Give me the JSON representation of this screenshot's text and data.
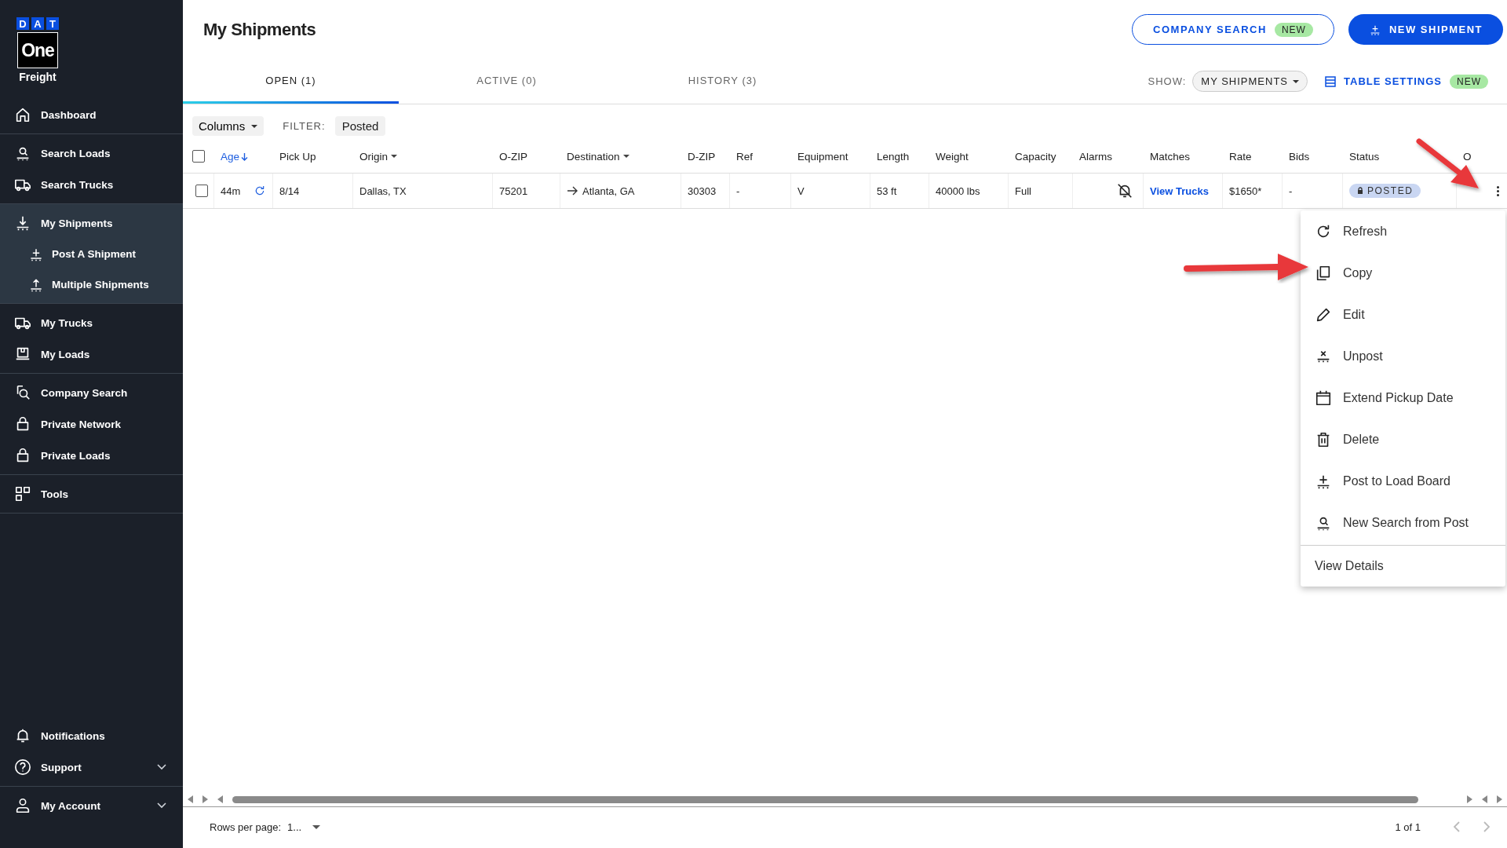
{
  "logo": {
    "letters": [
      "D",
      "A",
      "T"
    ],
    "wordmark": "One",
    "product": "Freight"
  },
  "sidebar": {
    "groups": [
      {
        "items": [
          {
            "label": "Dashboard",
            "kind": "home",
            "selected": false
          }
        ]
      },
      {
        "items": [
          {
            "label": "Search Loads",
            "kind": "search",
            "selected": false
          },
          {
            "label": "Search Trucks",
            "kind": "truck",
            "selected": false
          }
        ]
      },
      {
        "items": [
          {
            "label": "My Shipments",
            "kind": "download",
            "selected": true,
            "expanded": true,
            "children": [
              {
                "label": "Post A Shipment",
                "kind": "plus"
              },
              {
                "label": "Multiple Shipments",
                "kind": "upload"
              }
            ]
          }
        ]
      },
      {
        "items": [
          {
            "label": "My Trucks",
            "kind": "truck",
            "selected": false
          },
          {
            "label": "My Loads",
            "kind": "box",
            "selected": false
          }
        ]
      },
      {
        "items": [
          {
            "label": "Company Search",
            "kind": "find",
            "selected": false
          },
          {
            "label": "Private Network",
            "kind": "lock",
            "selected": false
          },
          {
            "label": "Private Loads",
            "kind": "lock",
            "selected": false
          }
        ]
      },
      {
        "items": [
          {
            "label": "Tools",
            "kind": "grid",
            "selected": false
          }
        ]
      }
    ],
    "bottom": [
      {
        "items": [
          {
            "label": "Notifications",
            "kind": "bell",
            "selected": false
          },
          {
            "label": "Support",
            "kind": "help",
            "selected": false,
            "expanded": false
          }
        ]
      },
      {
        "items": [
          {
            "label": "My Account",
            "kind": "user",
            "selected": false,
            "expanded": false
          }
        ]
      }
    ]
  },
  "header": {
    "title": "My Shipments",
    "buttons": [
      {
        "label": "COMPANY SEARCH",
        "badge": "NEW",
        "kind": "outline"
      },
      {
        "label": "NEW SHIPMENT",
        "kind": "primary"
      }
    ]
  },
  "tabs": [
    {
      "label": "OPEN (1)",
      "selected": true
    },
    {
      "label": "ACTIVE (0)",
      "selected": false
    },
    {
      "label": "HISTORY (3)",
      "selected": false
    }
  ],
  "show": {
    "label": "SHOW:",
    "value": "MY SHIPMENTS"
  },
  "table_settings": {
    "label": "TABLE SETTINGS",
    "badge": "NEW"
  },
  "toolbar": {
    "columns": "Columns",
    "filter_label": "FILTER:",
    "filter_value": "Posted"
  },
  "table": {
    "select_all": {
      "checked": false
    },
    "columns": [
      {
        "label": "Age",
        "kind": "sort"
      },
      {
        "label": "Pick Up",
        "kind": "plain"
      },
      {
        "label": "Origin",
        "kind": "menu"
      },
      {
        "label": "O-ZIP",
        "kind": "plain"
      },
      {
        "label": "Destination",
        "kind": "menu"
      },
      {
        "label": "D-ZIP",
        "kind": "plain"
      },
      {
        "label": "Ref",
        "kind": "plain"
      },
      {
        "label": "Equipment",
        "kind": "plain"
      },
      {
        "label": "Length",
        "kind": "plain"
      },
      {
        "label": "Weight",
        "kind": "plain"
      },
      {
        "label": "Capacity",
        "kind": "plain"
      },
      {
        "label": "Alarms",
        "kind": "plain"
      },
      {
        "label": "Matches",
        "kind": "plain"
      },
      {
        "label": "Rate",
        "kind": "plain"
      },
      {
        "label": "Bids",
        "kind": "plain"
      },
      {
        "label": "Status",
        "kind": "plain"
      },
      {
        "label": "O",
        "kind": "plain"
      }
    ],
    "rows": [
      {
        "checked": false,
        "cells": [
          {
            "kind": "age",
            "text": "44m"
          },
          {
            "kind": "text",
            "text": "8/14"
          },
          {
            "kind": "text",
            "text": "Dallas, TX"
          },
          {
            "kind": "text",
            "text": "75201"
          },
          {
            "kind": "route",
            "text": "Atlanta, GA"
          },
          {
            "kind": "text",
            "text": "30303"
          },
          {
            "kind": "text",
            "text": "-"
          },
          {
            "kind": "text",
            "text": "V"
          },
          {
            "kind": "text",
            "text": "53 ft"
          },
          {
            "kind": "text",
            "text": "40000 lbs"
          },
          {
            "kind": "text",
            "text": "Full"
          },
          {
            "kind": "alarm"
          },
          {
            "kind": "link",
            "text": "View Trucks"
          },
          {
            "kind": "text",
            "text": "$1650*"
          },
          {
            "kind": "text",
            "text": "-"
          },
          {
            "kind": "badge",
            "text": "POSTED"
          },
          {
            "kind": "menu"
          }
        ]
      }
    ]
  },
  "menu": {
    "items": [
      {
        "label": "Refresh",
        "kind": "refresh"
      },
      {
        "label": "Copy",
        "kind": "copy"
      },
      {
        "label": "Edit",
        "kind": "edit"
      },
      {
        "label": "Unpost",
        "kind": "unpost"
      },
      {
        "label": "Extend Pickup Date",
        "kind": "calendar"
      },
      {
        "label": "Delete",
        "kind": "trash"
      },
      {
        "label": "Post to Load Board",
        "kind": "plus"
      },
      {
        "label": "New Search from Post",
        "kind": "search"
      }
    ],
    "footer": "View Details"
  },
  "pagination": {
    "rows_label": "Rows per page:",
    "rows_value": "1...",
    "range": "1 of 1"
  }
}
